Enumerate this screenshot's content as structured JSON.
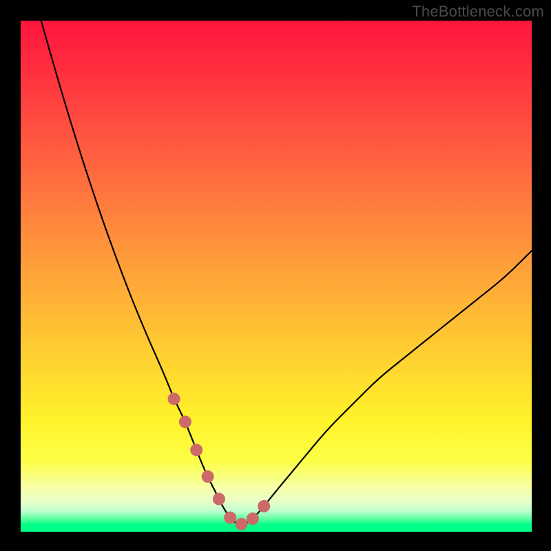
{
  "watermark": "TheBottleneck.com",
  "chart_data": {
    "type": "line",
    "title": "",
    "xlabel": "",
    "ylabel": "",
    "xlim": [
      0,
      100
    ],
    "ylim": [
      0,
      100
    ],
    "grid": false,
    "legend": false,
    "annotations": [],
    "series": [
      {
        "name": "bottleneck-curve",
        "x": [
          4,
          8,
          12,
          16,
          20,
          24,
          28,
          30,
          32,
          34,
          36,
          38,
          40,
          42,
          44,
          46,
          50,
          55,
          60,
          65,
          70,
          75,
          80,
          85,
          90,
          95,
          100
        ],
        "y": [
          100,
          86,
          73,
          61,
          50,
          40,
          31,
          26,
          22,
          17,
          12,
          8,
          4,
          1.5,
          1.5,
          3,
          8,
          14,
          20,
          25,
          30,
          34,
          38,
          42,
          46,
          50,
          55
        ]
      }
    ],
    "highlight_range_x": [
      30,
      48
    ],
    "background_gradient": {
      "direction": "vertical",
      "stops": [
        {
          "pos": 0.0,
          "color": "#ff153e"
        },
        {
          "pos": 0.3,
          "color": "#ff6a3f"
        },
        {
          "pos": 0.55,
          "color": "#ffb336"
        },
        {
          "pos": 0.78,
          "color": "#fff22a"
        },
        {
          "pos": 0.94,
          "color": "#e9ffc8"
        },
        {
          "pos": 0.986,
          "color": "#00ff88"
        },
        {
          "pos": 1.0,
          "color": "#00ff88"
        }
      ]
    }
  }
}
